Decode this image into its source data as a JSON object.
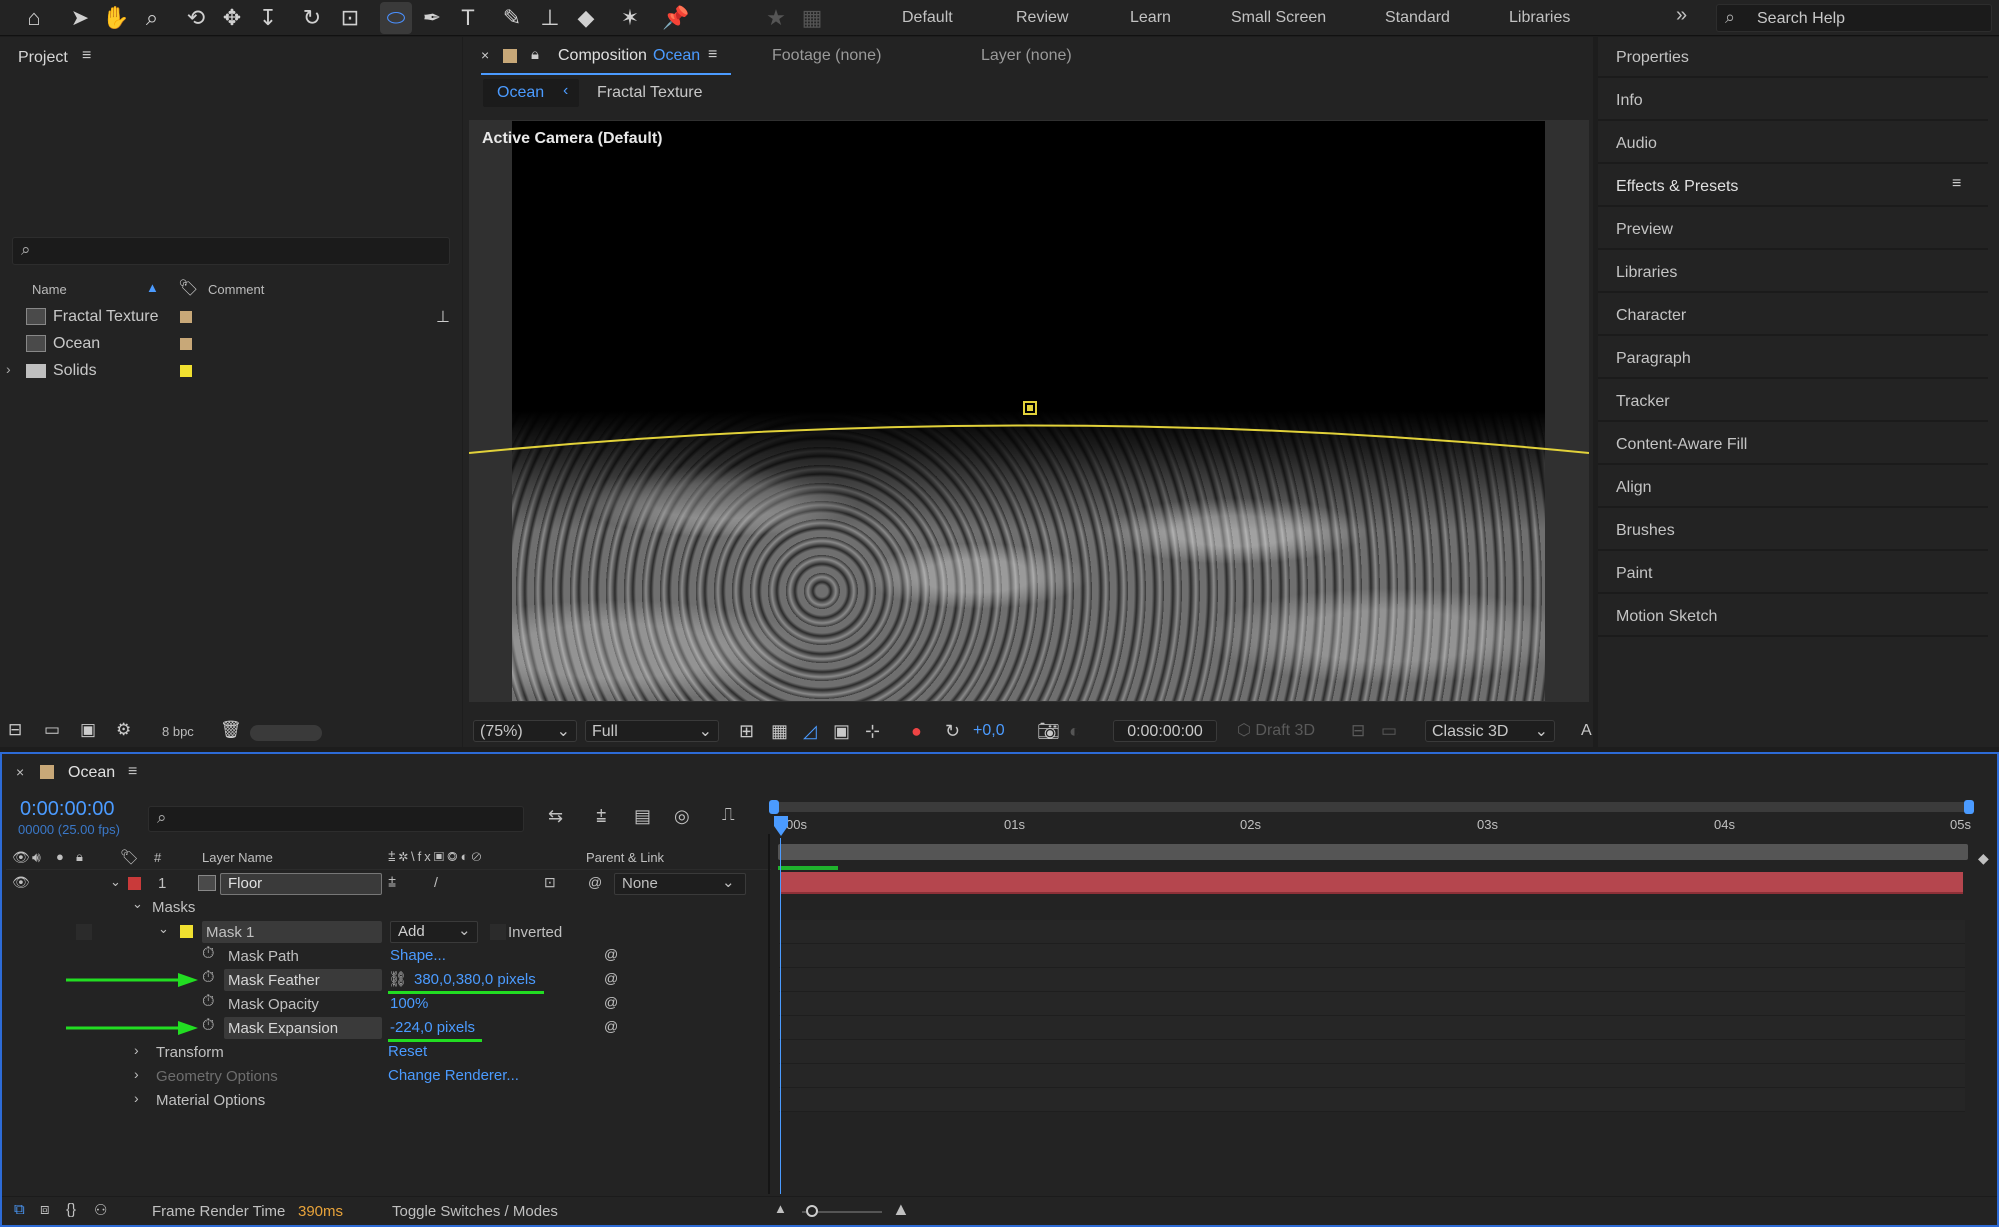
{
  "toolbar": {
    "workspaces": [
      "Default",
      "Review",
      "Learn",
      "Small Screen",
      "Standard",
      "Libraries"
    ],
    "search_placeholder": "Search Help",
    "overflow_label": "»"
  },
  "project": {
    "title": "Project",
    "columns": {
      "name": "Name",
      "comment": "Comment"
    },
    "items": [
      {
        "name": "Fractal Texture",
        "type": "composition",
        "color": "#c8a878"
      },
      {
        "name": "Ocean",
        "type": "composition",
        "color": "#c8a878"
      },
      {
        "name": "Solids",
        "type": "folder",
        "color": "#f0e030"
      }
    ],
    "bpc": "8 bpc"
  },
  "composition": {
    "tab_prefix": "Composition",
    "tab_name": "Ocean",
    "footage_tab": "Footage (none)",
    "layer_tab": "Layer (none)",
    "breadcrumbs": [
      "Ocean",
      "Fractal Texture"
    ],
    "camera_label": "Active Camera (Default)",
    "zoom": "(75%)",
    "resolution": "Full",
    "exposure": "+0,0",
    "timecode": "0:00:00:00",
    "draft3d": "Draft 3D",
    "renderer": "Classic 3D",
    "extra": "A"
  },
  "right_panels": [
    "Properties",
    "Info",
    "Audio",
    "Effects & Presets",
    "Preview",
    "Libraries",
    "Character",
    "Paragraph",
    "Tracker",
    "Content-Aware Fill",
    "Align",
    "Brushes",
    "Paint",
    "Motion Sketch"
  ],
  "timeline": {
    "comp_name": "Ocean",
    "timecode": "0:00:00:00",
    "frame_info": "00000 (25.00 fps)",
    "col_hash": "#",
    "col_layer_name": "Layer Name",
    "col_parent": "Parent & Link",
    "layer": {
      "index": "1",
      "name": "Floor",
      "parent": "None",
      "color": "#c93a3a"
    },
    "masks_label": "Masks",
    "mask": {
      "name": "Mask 1",
      "mode": "Add",
      "inverted": "Inverted"
    },
    "props": [
      {
        "name": "Mask Path",
        "value": "Shape..."
      },
      {
        "name": "Mask Feather",
        "value": "380,0,380,0 pixels"
      },
      {
        "name": "Mask Opacity",
        "value": "100%"
      },
      {
        "name": "Mask Expansion",
        "value": "-224,0 pixels"
      }
    ],
    "groups": [
      {
        "name": "Transform",
        "value": "Reset"
      },
      {
        "name": "Geometry Options",
        "value": "Change Renderer..."
      },
      {
        "name": "Material Options",
        "value": ""
      }
    ],
    "ruler": [
      "00s",
      "01s",
      "02s",
      "03s",
      "04s",
      "05s"
    ],
    "frame_render_label": "Frame Render Time",
    "frame_render_value": "390ms",
    "toggle_label": "Toggle Switches / Modes"
  }
}
